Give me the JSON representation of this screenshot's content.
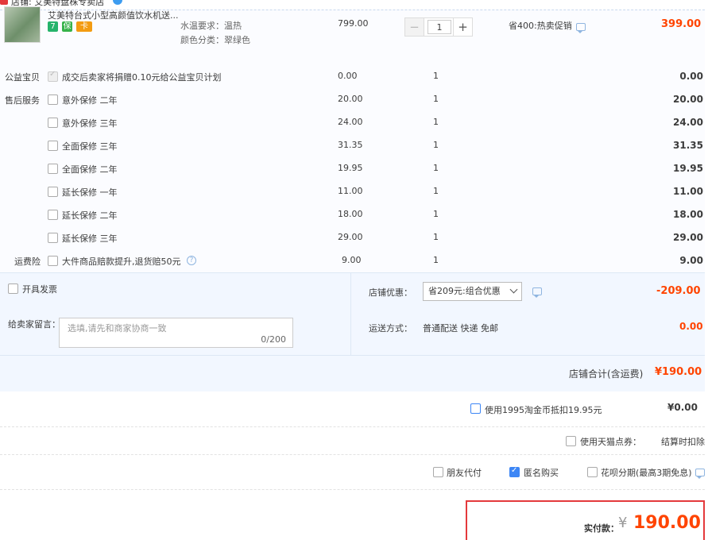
{
  "shop": {
    "name": "店铺: 艾美特盘株专卖店"
  },
  "item": {
    "title": "艾美特台式小型高颜值饮水机送...",
    "tags": [
      "7",
      "保",
      "卡"
    ],
    "spec_water_label": "水温要求：温热",
    "spec_color_label": "颜色分类：翠绿色",
    "unit_price": "799.00",
    "quantity": "1",
    "promo": "省400:热卖促销",
    "amount": "399.00"
  },
  "services": {
    "charity_label": "公益宝贝",
    "charity_text": "成交后卖家将捐赠0.10元给公益宝贝计划",
    "charity_price": "0.00",
    "charity_qty": "1",
    "charity_amount": "0.00",
    "after_sale_label": "售后服务",
    "freight_label": "运费险",
    "rows": [
      {
        "name": "意外保修 二年",
        "price": "20.00",
        "qty": "1",
        "amount": "20.00"
      },
      {
        "name": "意外保修 三年",
        "price": "24.00",
        "qty": "1",
        "amount": "24.00"
      },
      {
        "name": "全面保修 三年",
        "price": "31.35",
        "qty": "1",
        "amount": "31.35"
      },
      {
        "name": "全面保修 二年",
        "price": "19.95",
        "qty": "1",
        "amount": "19.95"
      },
      {
        "name": "延长保修 一年",
        "price": "11.00",
        "qty": "1",
        "amount": "11.00"
      },
      {
        "name": "延长保修 二年",
        "price": "18.00",
        "qty": "1",
        "amount": "18.00"
      },
      {
        "name": "延长保修 三年",
        "price": "29.00",
        "qty": "1",
        "amount": "29.00"
      },
      {
        "name": "大件商品赔款提升,退货赔50元",
        "price": "9.00",
        "qty": "1",
        "amount": "9.00"
      }
    ]
  },
  "invoice": {
    "label": "开具发票"
  },
  "message": {
    "label": "给卖家留言：",
    "placeholder": "选填,请先和商家协商一致",
    "counter": "0/200"
  },
  "discount": {
    "label": "店铺优惠：",
    "selected": "省209元:组合优惠",
    "amount": "-209.00"
  },
  "shipping": {
    "label": "运送方式：",
    "value": "普通配送 快递 免邮",
    "amount": "0.00"
  },
  "shop_total": {
    "label": "店铺合计(含运费)",
    "value": "¥190.00"
  },
  "coins": {
    "label": "使用1995淘金币抵扣19.95元",
    "value": "¥0.00"
  },
  "tmall_points": {
    "label": "使用天猫点券：",
    "note": "结算时扣除"
  },
  "options": {
    "friend_pay": "朋友代付",
    "anonymous": "匿名购买",
    "huabei": "花呗分期(最高3期免息)"
  },
  "payment": {
    "label": "实付款：",
    "currency": "¥",
    "amount": "190.00"
  },
  "colors": {
    "accent_red": "#f40",
    "checkbox_blue": "#3d86f5",
    "panel_bg": "#f2f7ff"
  }
}
